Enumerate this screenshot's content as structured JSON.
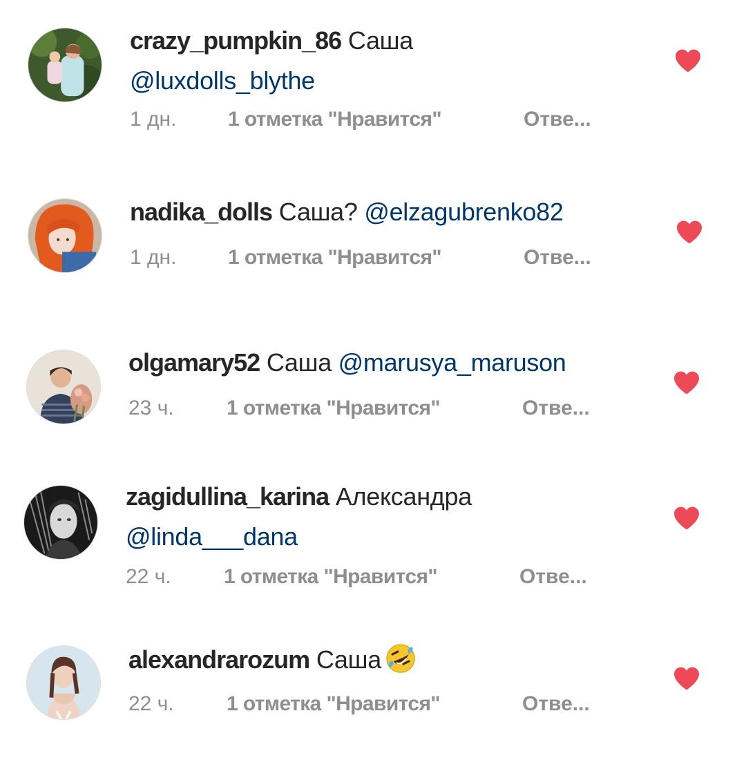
{
  "comments": [
    {
      "username": "crazy_pumpkin_86",
      "text": "Саша",
      "mention": "@luxdolls_blythe",
      "time": "1 дн.",
      "likes": "1 отметка \"Нравится\"",
      "reply": "Отве...",
      "avatar_icon": "mother-with-child-avatar-icon"
    },
    {
      "username": "nadika_dolls",
      "text": "Саша?",
      "mention": "@elzagubrenko82",
      "time": "1 дн.",
      "likes": "1 отметка \"Нравится\"",
      "reply": "Отве...",
      "avatar_icon": "red-haired-doll-avatar-icon"
    },
    {
      "username": "olgamary52",
      "text": "Саша",
      "mention": "@marusya_maruson",
      "time": "23 ч.",
      "likes": "1 отметка \"Нравится\"",
      "reply": "Отве...",
      "avatar_icon": "woman-with-flowers-avatar-icon"
    },
    {
      "username": "zagidullina_karina",
      "text": "Александра",
      "mention": "@linda___dana",
      "time": "22 ч.",
      "likes": "1 отметка \"Нравится\"",
      "reply": "Отве...",
      "avatar_icon": "black-white-portrait-avatar-icon"
    },
    {
      "username": "alexandrarozum",
      "text": "Саша",
      "mention": "",
      "emoji": "rolling-on-floor-laughing-emoji",
      "time": "22 ч.",
      "likes": "1 отметка \"Нравится\"",
      "reply": "Отве...",
      "avatar_icon": "woman-portrait-avatar-icon"
    }
  ],
  "colors": {
    "heart": "#ed4956",
    "mention": "#00376b",
    "meta": "#8e8e8e",
    "text": "#262626"
  },
  "icons": {
    "like": "heart-icon"
  }
}
